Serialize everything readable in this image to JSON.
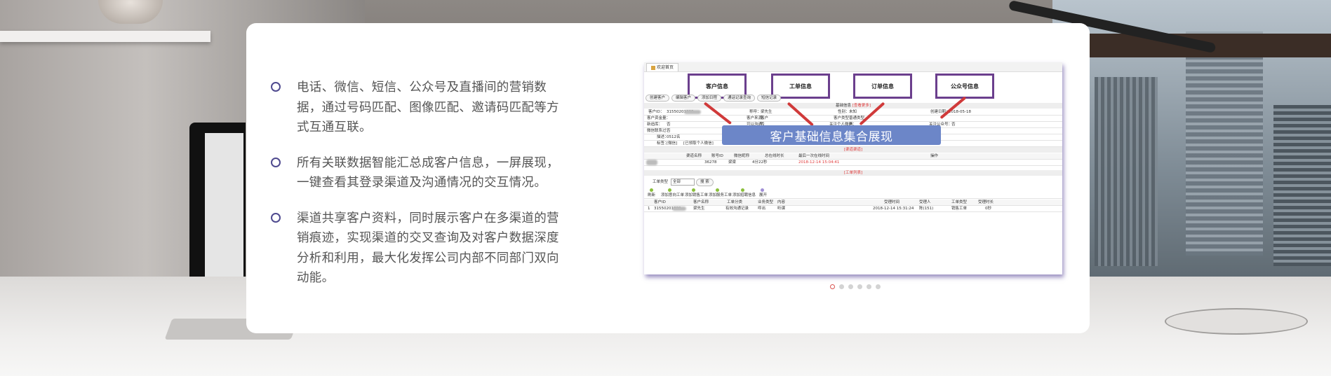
{
  "features": [
    {
      "text": "电话、微信、短信、公众号及直播间的营销数据，通过号码匹配、图像匹配、邀请码匹配等方式互通互联。"
    },
    {
      "text": "所有关联数据智能汇总成客户信息，一屏展现，一键查看其登录渠道及沟通情况的交互情况。"
    },
    {
      "text": "渠道共享客户资料，同时展示客户在多渠道的营销痕迹，实现渠道的交叉查询及对客户数据深度分析和利用，最大化发挥公司内部不同部门双向动能。"
    }
  ],
  "slide": {
    "tab_label": "欢迎首页",
    "highlight_labels": [
      "客户信息",
      "工单信息",
      "订单信息",
      "公众号信息"
    ],
    "action_buttons": [
      "创建客户",
      "编辑客户",
      "添加日程",
      "通话记录查询",
      "短信记录"
    ],
    "basic_section": {
      "title": "基础信息",
      "link": "[查看更多]"
    },
    "basic_fields": {
      "r1": [
        "客户ID：",
        "31550201800",
        "称呼：",
        "梁先生",
        "性别：",
        "未知",
        "创建日期：",
        "2018-05-18"
      ],
      "r2": [
        "客户资金量：",
        "",
        "客户来源：",
        "客户",
        "客户类型：",
        "普通类型",
        "",
        ""
      ],
      "r3": [
        "新追库：",
        "否",
        "可以沟通：",
        "否",
        "关注个人微信：",
        "否",
        "关注公众号：",
        "否"
      ],
      "r4": [
        "微信联系过：",
        "否",
        "禁止沟通：",
        "否"
      ],
      "r5": [
        "描述：",
        "0512名"
      ],
      "r6": [
        "标签：",
        "[微信]",
        "[已领取个人微信]"
      ]
    },
    "banner_text": "客户基础信息集合展现",
    "channel_section": {
      "title": "[渠道渠道]"
    },
    "channel_headers": [
      "渠道名称",
      "账号ID",
      "微信昵称",
      "总在线时长",
      "最后一次在线时间",
      "操作"
    ],
    "channel_row": [
      "",
      "36278",
      "梁梁",
      "4分22秒",
      "2018-12-14 15:04:41",
      ""
    ],
    "ticket_section": {
      "title": "[工单列表]"
    },
    "filter": {
      "label": "工单类型",
      "value": "全部",
      "search_label": "搜 索"
    },
    "toolbar_buttons": [
      "刷新",
      "添加意向工单",
      "添加销售工单",
      "添加服务工单",
      "添加招聘信息",
      "展开"
    ],
    "ticket_headers": [
      "客户ID",
      "客户名称",
      "工单分类",
      "业务类型",
      "内容",
      "受理时间",
      "受理人",
      "工单类型",
      "受理时长"
    ],
    "ticket_row": [
      "1",
      "31550201800",
      "梁先生",
      "有效沟通记录",
      "呼出",
      "听课",
      "2018-12-14 15:31:24",
      "陈(151)",
      "销售工单",
      "0秒"
    ]
  },
  "carousel": {
    "count": 6,
    "active_index": 0
  },
  "colors": {
    "bullet": "#4f4a8f",
    "highlight_border": "#6b3f8d",
    "banner": "#6c86c8",
    "arrow": "#d03a3a",
    "active_dot": "#d9534f"
  }
}
